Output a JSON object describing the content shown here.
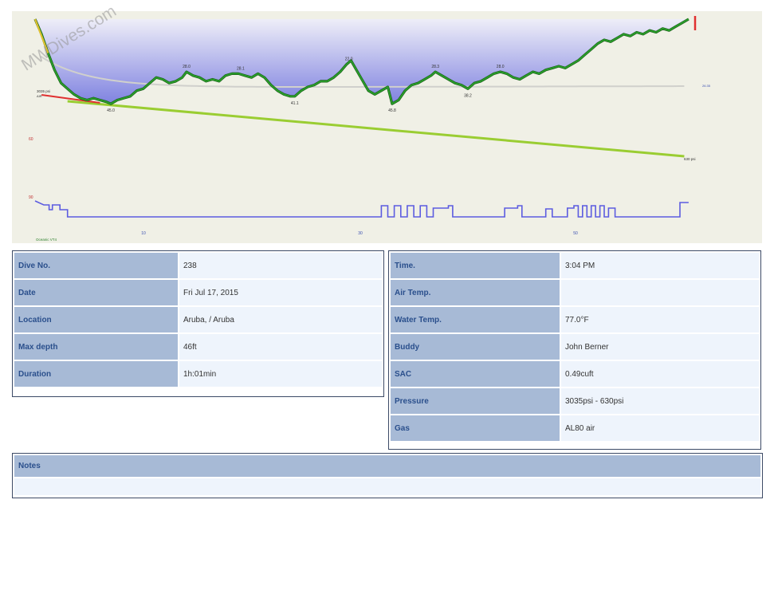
{
  "watermark": "MWDives.com",
  "profile": {
    "colors": {
      "background": "#f0f0e6",
      "depth_fill_top": "#eeeef8",
      "depth_fill_bottom": "#7f82e0",
      "depth_line": "#2aa02a",
      "tank_line": "#9acd32",
      "heartbeat_line": "#5c5ce0",
      "sac_line": "#d0d0cc",
      "ascent_warn": "#e03030"
    },
    "depth_axis_labels": [
      "60",
      "90"
    ],
    "time_axis_labels": [
      "10",
      "30",
      "50"
    ],
    "start_pressure_label": "3035 psi",
    "start_gas_label": "AIR",
    "end_pressure_label": "630 psi",
    "sac_end_label": "26.35",
    "computer_label": "Oceanic VT4",
    "depth_markers": [
      {
        "minute": 7,
        "label": "45.0",
        "pos": "below"
      },
      {
        "minute": 14,
        "label": "28.0",
        "pos": "above"
      },
      {
        "minute": 19,
        "label": "28.1",
        "pos": "above"
      },
      {
        "minute": 24,
        "label": "41.1",
        "pos": "below"
      },
      {
        "minute": 29,
        "label": "22.0",
        "pos": "above"
      },
      {
        "minute": 33,
        "label": "45.8",
        "pos": "below"
      },
      {
        "minute": 37,
        "label": "28.3",
        "pos": "above"
      },
      {
        "minute": 40,
        "label": "38.2",
        "pos": "below"
      },
      {
        "minute": 43,
        "label": "28.0",
        "pos": "above"
      }
    ],
    "depth_profile": [
      [
        0,
        0
      ],
      [
        0.6,
        8
      ],
      [
        1.2,
        18
      ],
      [
        1.8,
        27
      ],
      [
        2.4,
        34
      ],
      [
        3,
        37
      ],
      [
        3.6,
        40
      ],
      [
        4.2,
        42
      ],
      [
        4.8,
        43
      ],
      [
        5.4,
        42
      ],
      [
        6,
        43
      ],
      [
        6.6,
        44
      ],
      [
        7,
        45
      ],
      [
        7.6,
        43
      ],
      [
        8.2,
        42
      ],
      [
        8.8,
        41
      ],
      [
        9.4,
        38
      ],
      [
        10,
        37
      ],
      [
        10.6,
        34
      ],
      [
        11.2,
        31
      ],
      [
        11.8,
        32
      ],
      [
        12.4,
        34
      ],
      [
        13,
        33
      ],
      [
        13.6,
        31
      ],
      [
        14,
        28
      ],
      [
        14.6,
        30
      ],
      [
        15.2,
        31
      ],
      [
        15.8,
        33
      ],
      [
        16.4,
        32
      ],
      [
        17,
        33
      ],
      [
        17.6,
        30
      ],
      [
        18.2,
        29
      ],
      [
        18.8,
        29
      ],
      [
        19.4,
        30
      ],
      [
        20,
        31
      ],
      [
        20.6,
        29
      ],
      [
        21.2,
        31
      ],
      [
        21.8,
        35
      ],
      [
        22.4,
        38
      ],
      [
        23,
        40
      ],
      [
        23.6,
        41
      ],
      [
        24,
        41
      ],
      [
        24.6,
        38
      ],
      [
        25.2,
        36
      ],
      [
        25.8,
        35
      ],
      [
        26.4,
        33
      ],
      [
        27,
        33
      ],
      [
        27.6,
        31
      ],
      [
        28.2,
        28
      ],
      [
        28.8,
        24
      ],
      [
        29.2,
        22
      ],
      [
        29.6,
        26
      ],
      [
        30.2,
        32
      ],
      [
        30.8,
        38
      ],
      [
        31.4,
        40
      ],
      [
        32,
        38
      ],
      [
        32.6,
        36
      ],
      [
        33,
        45
      ],
      [
        33.6,
        43
      ],
      [
        34.2,
        38
      ],
      [
        34.8,
        35
      ],
      [
        35.4,
        34
      ],
      [
        36,
        32
      ],
      [
        36.6,
        30
      ],
      [
        37,
        28
      ],
      [
        37.6,
        30
      ],
      [
        38.2,
        32
      ],
      [
        38.8,
        34
      ],
      [
        39.4,
        35
      ],
      [
        40,
        37
      ],
      [
        40.6,
        34
      ],
      [
        41.2,
        33
      ],
      [
        41.8,
        31
      ],
      [
        42.4,
        29
      ],
      [
        43,
        28
      ],
      [
        43.6,
        29
      ],
      [
        44.2,
        31
      ],
      [
        44.8,
        32
      ],
      [
        45.4,
        30
      ],
      [
        46,
        28
      ],
      [
        46.6,
        29
      ],
      [
        47.2,
        27
      ],
      [
        47.8,
        26
      ],
      [
        48.4,
        25
      ],
      [
        49,
        26
      ],
      [
        49.6,
        24
      ],
      [
        50.2,
        22
      ],
      [
        50.8,
        19
      ],
      [
        51.4,
        16
      ],
      [
        52,
        13
      ],
      [
        52.6,
        11
      ],
      [
        53.2,
        12
      ],
      [
        53.8,
        10
      ],
      [
        54.4,
        8
      ],
      [
        55,
        9
      ],
      [
        55.6,
        7
      ],
      [
        56.2,
        8
      ],
      [
        56.8,
        6
      ],
      [
        57.4,
        7
      ],
      [
        58,
        5
      ],
      [
        58.6,
        6
      ],
      [
        59.2,
        4
      ],
      [
        59.8,
        2
      ],
      [
        60.4,
        0
      ]
    ],
    "heartbeat_steps": [
      [
        0,
        0
      ],
      [
        0.8,
        0.25
      ],
      [
        1.3,
        0.25
      ],
      [
        1.3,
        0.55
      ],
      [
        1.6,
        0.55
      ],
      [
        1.6,
        0.25
      ],
      [
        2.3,
        0.25
      ],
      [
        2.3,
        0.55
      ],
      [
        3,
        0.55
      ],
      [
        3,
        1
      ],
      [
        32,
        1
      ],
      [
        32,
        0.3
      ],
      [
        32.6,
        0.3
      ],
      [
        32.6,
        1
      ],
      [
        33.2,
        1
      ],
      [
        33.2,
        0.3
      ],
      [
        33.8,
        0.3
      ],
      [
        33.8,
        1
      ],
      [
        34.4,
        1
      ],
      [
        34.4,
        0.3
      ],
      [
        35,
        0.3
      ],
      [
        35,
        1
      ],
      [
        35.6,
        1
      ],
      [
        35.6,
        0.3
      ],
      [
        36.2,
        0.3
      ],
      [
        36.2,
        1
      ],
      [
        36.8,
        1
      ],
      [
        36.8,
        0.45
      ],
      [
        38.2,
        0.45
      ],
      [
        38.2,
        0.3
      ],
      [
        38.6,
        0.3
      ],
      [
        38.6,
        1
      ],
      [
        43.4,
        1
      ],
      [
        43.4,
        0.45
      ],
      [
        44.6,
        0.45
      ],
      [
        44.6,
        0.3
      ],
      [
        45,
        0.3
      ],
      [
        45,
        1
      ],
      [
        47.2,
        1
      ],
      [
        47.2,
        0.5
      ],
      [
        47.8,
        0.5
      ],
      [
        47.8,
        1
      ],
      [
        49.2,
        1
      ],
      [
        49.2,
        0.45
      ],
      [
        49.8,
        0.45
      ],
      [
        49.8,
        0.3
      ],
      [
        50.2,
        0.3
      ],
      [
        50.2,
        1
      ],
      [
        50.6,
        1
      ],
      [
        50.6,
        0.3
      ],
      [
        51,
        0.3
      ],
      [
        51,
        1
      ],
      [
        51.4,
        1
      ],
      [
        51.4,
        0.3
      ],
      [
        51.8,
        0.3
      ],
      [
        51.8,
        1
      ],
      [
        52.2,
        1
      ],
      [
        52.2,
        0.3
      ],
      [
        52.6,
        0.3
      ],
      [
        52.6,
        1
      ],
      [
        53,
        1
      ],
      [
        53,
        0.45
      ],
      [
        53.6,
        0.45
      ],
      [
        53.6,
        1
      ],
      [
        59.6,
        1
      ],
      [
        59.6,
        0.1
      ],
      [
        60.4,
        0.1
      ]
    ],
    "max_minute": 61,
    "max_depth": 50
  },
  "left_table": [
    {
      "label": "Dive No.",
      "value": "238"
    },
    {
      "label": "Date",
      "value": "Fri Jul 17, 2015"
    },
    {
      "label": "Location",
      "value": "Aruba, / Aruba"
    },
    {
      "label": "Max depth",
      "value": "46ft"
    },
    {
      "label": "Duration",
      "value": "1h:01min"
    }
  ],
  "right_table": [
    {
      "label": "Time.",
      "value": "3:04 PM"
    },
    {
      "label": "Air Temp.",
      "value": ""
    },
    {
      "label": "Water Temp.",
      "value": "77.0°F"
    },
    {
      "label": "Buddy",
      "value": "John Berner"
    },
    {
      "label": "SAC",
      "value": "0.49cuft"
    },
    {
      "label": "Pressure",
      "value": "3035psi - 630psi"
    },
    {
      "label": "Gas",
      "value": "AL80 air"
    }
  ],
  "notes": {
    "label": "Notes",
    "value": ""
  }
}
